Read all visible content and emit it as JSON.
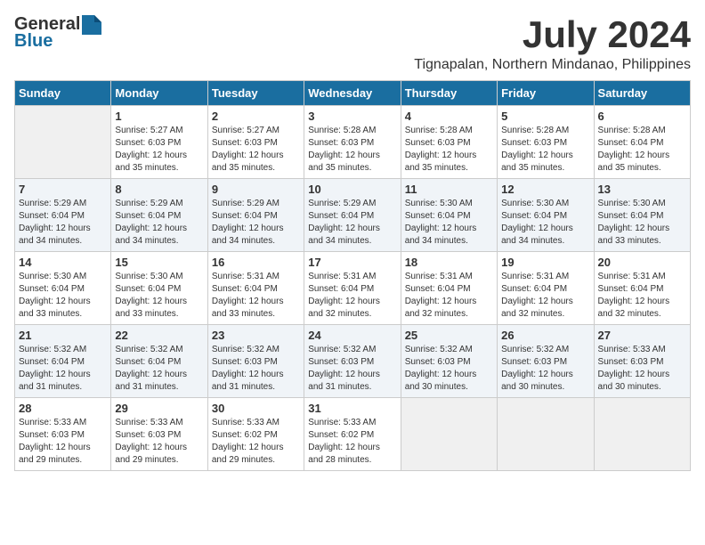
{
  "header": {
    "logo_general": "General",
    "logo_blue": "Blue",
    "month_title": "July 2024",
    "location": "Tignapalan, Northern Mindanao, Philippines"
  },
  "days_of_week": [
    "Sunday",
    "Monday",
    "Tuesday",
    "Wednesday",
    "Thursday",
    "Friday",
    "Saturday"
  ],
  "weeks": [
    [
      {
        "day": "",
        "detail": ""
      },
      {
        "day": "1",
        "detail": "Sunrise: 5:27 AM\nSunset: 6:03 PM\nDaylight: 12 hours\nand 35 minutes."
      },
      {
        "day": "2",
        "detail": "Sunrise: 5:27 AM\nSunset: 6:03 PM\nDaylight: 12 hours\nand 35 minutes."
      },
      {
        "day": "3",
        "detail": "Sunrise: 5:28 AM\nSunset: 6:03 PM\nDaylight: 12 hours\nand 35 minutes."
      },
      {
        "day": "4",
        "detail": "Sunrise: 5:28 AM\nSunset: 6:03 PM\nDaylight: 12 hours\nand 35 minutes."
      },
      {
        "day": "5",
        "detail": "Sunrise: 5:28 AM\nSunset: 6:03 PM\nDaylight: 12 hours\nand 35 minutes."
      },
      {
        "day": "6",
        "detail": "Sunrise: 5:28 AM\nSunset: 6:04 PM\nDaylight: 12 hours\nand 35 minutes."
      }
    ],
    [
      {
        "day": "7",
        "detail": "Sunrise: 5:29 AM\nSunset: 6:04 PM\nDaylight: 12 hours\nand 34 minutes."
      },
      {
        "day": "8",
        "detail": "Sunrise: 5:29 AM\nSunset: 6:04 PM\nDaylight: 12 hours\nand 34 minutes."
      },
      {
        "day": "9",
        "detail": "Sunrise: 5:29 AM\nSunset: 6:04 PM\nDaylight: 12 hours\nand 34 minutes."
      },
      {
        "day": "10",
        "detail": "Sunrise: 5:29 AM\nSunset: 6:04 PM\nDaylight: 12 hours\nand 34 minutes."
      },
      {
        "day": "11",
        "detail": "Sunrise: 5:30 AM\nSunset: 6:04 PM\nDaylight: 12 hours\nand 34 minutes."
      },
      {
        "day": "12",
        "detail": "Sunrise: 5:30 AM\nSunset: 6:04 PM\nDaylight: 12 hours\nand 34 minutes."
      },
      {
        "day": "13",
        "detail": "Sunrise: 5:30 AM\nSunset: 6:04 PM\nDaylight: 12 hours\nand 33 minutes."
      }
    ],
    [
      {
        "day": "14",
        "detail": "Sunrise: 5:30 AM\nSunset: 6:04 PM\nDaylight: 12 hours\nand 33 minutes."
      },
      {
        "day": "15",
        "detail": "Sunrise: 5:30 AM\nSunset: 6:04 PM\nDaylight: 12 hours\nand 33 minutes."
      },
      {
        "day": "16",
        "detail": "Sunrise: 5:31 AM\nSunset: 6:04 PM\nDaylight: 12 hours\nand 33 minutes."
      },
      {
        "day": "17",
        "detail": "Sunrise: 5:31 AM\nSunset: 6:04 PM\nDaylight: 12 hours\nand 32 minutes."
      },
      {
        "day": "18",
        "detail": "Sunrise: 5:31 AM\nSunset: 6:04 PM\nDaylight: 12 hours\nand 32 minutes."
      },
      {
        "day": "19",
        "detail": "Sunrise: 5:31 AM\nSunset: 6:04 PM\nDaylight: 12 hours\nand 32 minutes."
      },
      {
        "day": "20",
        "detail": "Sunrise: 5:31 AM\nSunset: 6:04 PM\nDaylight: 12 hours\nand 32 minutes."
      }
    ],
    [
      {
        "day": "21",
        "detail": "Sunrise: 5:32 AM\nSunset: 6:04 PM\nDaylight: 12 hours\nand 31 minutes."
      },
      {
        "day": "22",
        "detail": "Sunrise: 5:32 AM\nSunset: 6:04 PM\nDaylight: 12 hours\nand 31 minutes."
      },
      {
        "day": "23",
        "detail": "Sunrise: 5:32 AM\nSunset: 6:03 PM\nDaylight: 12 hours\nand 31 minutes."
      },
      {
        "day": "24",
        "detail": "Sunrise: 5:32 AM\nSunset: 6:03 PM\nDaylight: 12 hours\nand 31 minutes."
      },
      {
        "day": "25",
        "detail": "Sunrise: 5:32 AM\nSunset: 6:03 PM\nDaylight: 12 hours\nand 30 minutes."
      },
      {
        "day": "26",
        "detail": "Sunrise: 5:32 AM\nSunset: 6:03 PM\nDaylight: 12 hours\nand 30 minutes."
      },
      {
        "day": "27",
        "detail": "Sunrise: 5:33 AM\nSunset: 6:03 PM\nDaylight: 12 hours\nand 30 minutes."
      }
    ],
    [
      {
        "day": "28",
        "detail": "Sunrise: 5:33 AM\nSunset: 6:03 PM\nDaylight: 12 hours\nand 29 minutes."
      },
      {
        "day": "29",
        "detail": "Sunrise: 5:33 AM\nSunset: 6:03 PM\nDaylight: 12 hours\nand 29 minutes."
      },
      {
        "day": "30",
        "detail": "Sunrise: 5:33 AM\nSunset: 6:02 PM\nDaylight: 12 hours\nand 29 minutes."
      },
      {
        "day": "31",
        "detail": "Sunrise: 5:33 AM\nSunset: 6:02 PM\nDaylight: 12 hours\nand 28 minutes."
      },
      {
        "day": "",
        "detail": ""
      },
      {
        "day": "",
        "detail": ""
      },
      {
        "day": "",
        "detail": ""
      }
    ]
  ]
}
